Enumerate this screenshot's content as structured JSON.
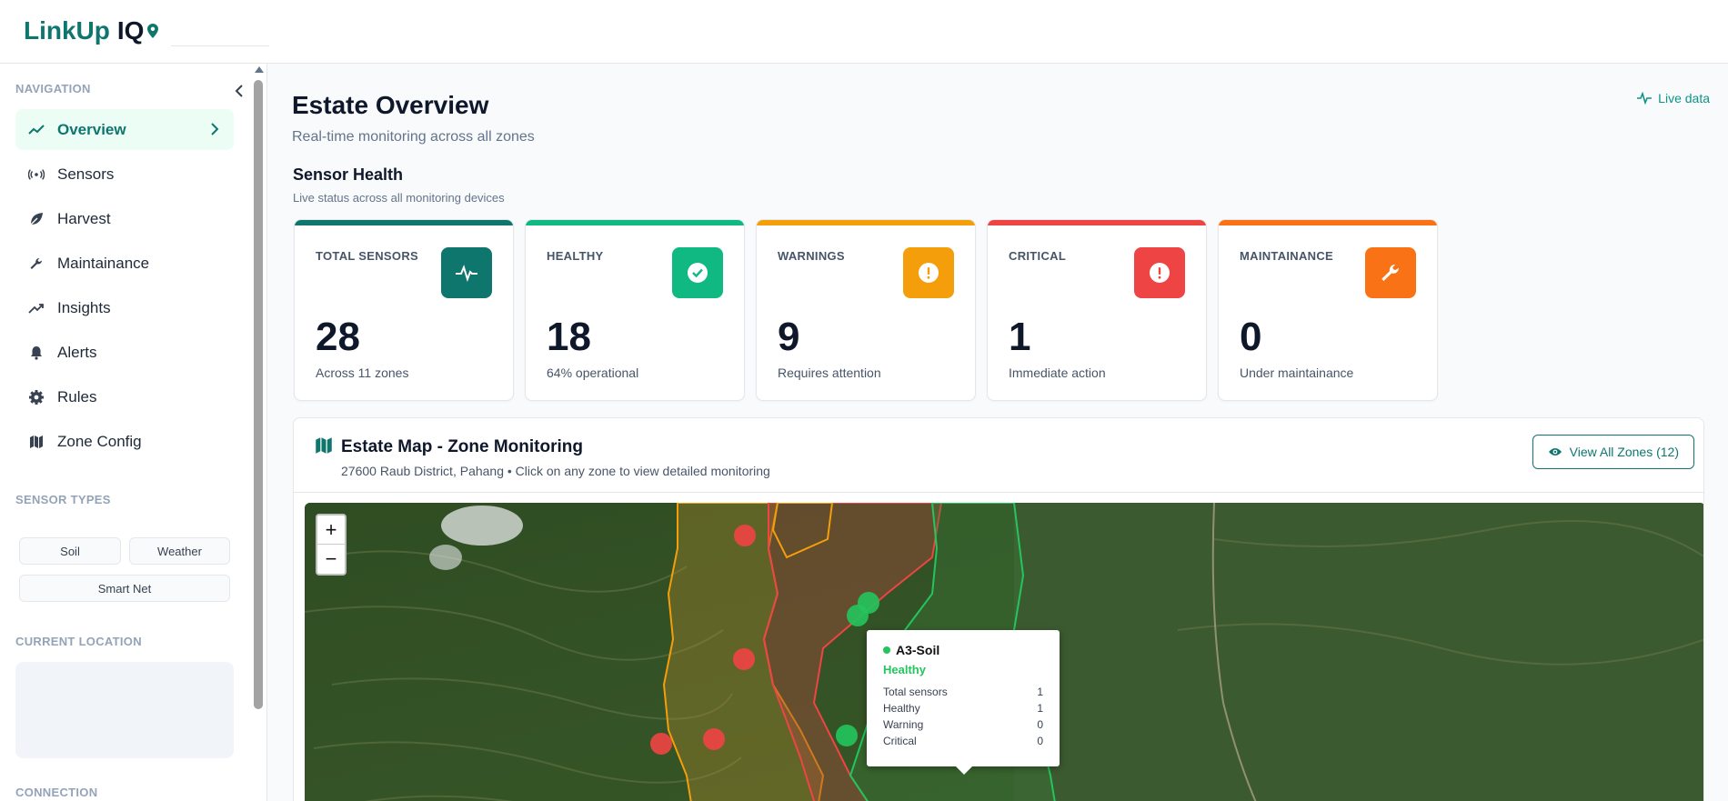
{
  "app": {
    "brand": "LinkUp",
    "brand_suffix": "IQ"
  },
  "sidebar": {
    "nav_heading": "NAVIGATION",
    "items": [
      {
        "label": "Overview",
        "icon": "trend-icon",
        "active": true
      },
      {
        "label": "Sensors",
        "icon": "signal-icon"
      },
      {
        "label": "Harvest",
        "icon": "leaf-icon"
      },
      {
        "label": "Maintainance",
        "icon": "wrench-icon"
      },
      {
        "label": "Insights",
        "icon": "trending-up-icon"
      },
      {
        "label": "Alerts",
        "icon": "bell-icon"
      },
      {
        "label": "Rules",
        "icon": "gear-icon"
      },
      {
        "label": "Zone Config",
        "icon": "map-icon"
      }
    ],
    "sensor_types_heading": "SENSOR TYPES",
    "sensor_types": [
      "Soil",
      "Weather",
      "Smart Net"
    ],
    "location_heading": "CURRENT LOCATION",
    "connection_heading": "CONNECTION"
  },
  "main": {
    "title": "Estate Overview",
    "subtitle": "Real-time monitoring across all zones",
    "live_label": "Live data",
    "section_title": "Sensor Health",
    "section_subtitle": "Live status across all monitoring devices"
  },
  "cards": [
    {
      "label": "TOTAL SENSORS",
      "value": "28",
      "note": "Across 11 zones",
      "color": "#0f766e",
      "icon": "pulse-icon"
    },
    {
      "label": "HEALTHY",
      "value": "18",
      "note": "64% operational",
      "color": "#10b981",
      "icon": "check-circle-icon"
    },
    {
      "label": "WARNINGS",
      "value": "9",
      "note": "Requires attention",
      "color": "#f59e0b",
      "icon": "warning-circle-icon"
    },
    {
      "label": "CRITICAL",
      "value": "1",
      "note": "Immediate action",
      "color": "#ef4444",
      "icon": "alert-circle-icon"
    },
    {
      "label": "MAINTAINANCE",
      "value": "0",
      "note": "Under maintainance",
      "color": "#f97316",
      "icon": "wrench-icon"
    }
  ],
  "map": {
    "title": "Estate Map - Zone Monitoring",
    "subtitle": "27600 Raub District, Pahang • Click on any zone to view detailed monitoring",
    "view_all_label": "View All Zones (12)",
    "zoom_in": "+",
    "zoom_out": "−",
    "popup": {
      "zone": "A3-Soil",
      "status": "Healthy",
      "rows": [
        {
          "label": "Total sensors",
          "value": "1"
        },
        {
          "label": "Healthy",
          "value": "1"
        },
        {
          "label": "Warning",
          "value": "0"
        },
        {
          "label": "Critical",
          "value": "0"
        }
      ]
    }
  },
  "colors": {
    "accent": "#0f766e",
    "healthy": "#22c55e",
    "warning": "#f59e0b",
    "critical": "#ef4444"
  }
}
